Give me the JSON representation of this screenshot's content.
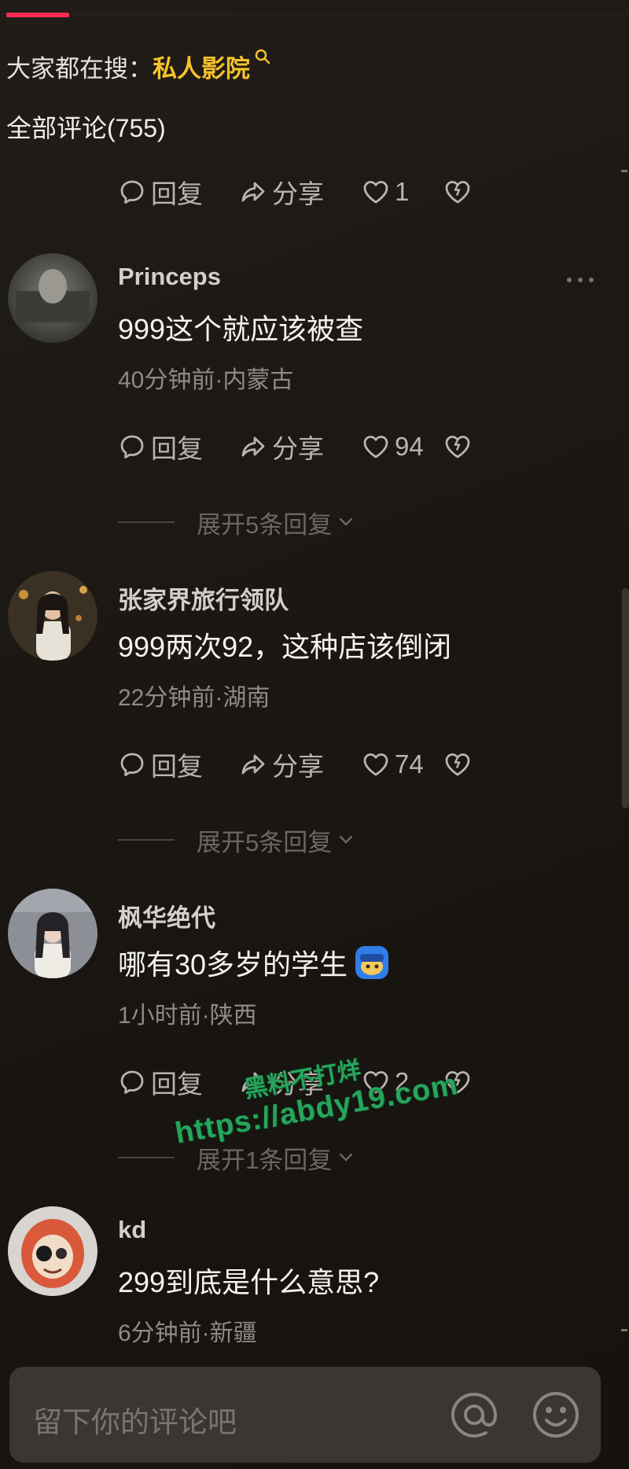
{
  "header": {
    "search_prefix": "大家都在搜：",
    "search_keyword": "私人影院",
    "comments_label": "全部评论(755)"
  },
  "actions": {
    "reply": "回复",
    "share": "分享"
  },
  "orphan_row": {
    "likes": "1"
  },
  "comments": [
    {
      "user": "Princeps",
      "text": "999这个就应该被查",
      "meta": "40分钟前·内蒙古",
      "likes": "94",
      "expand": "展开5条回复"
    },
    {
      "user": "张家界旅行领队",
      "text": "999两次92，这种店该倒闭",
      "meta": "22分钟前·湖南",
      "likes": "74",
      "expand": "展开5条回复"
    },
    {
      "user": "枫华绝代",
      "text": "哪有30多岁的学生",
      "meta": "1小时前·陕西",
      "likes": "2",
      "expand": "展开1条回复"
    },
    {
      "user": "kd",
      "text": "299到底是什么意思?",
      "meta": "6分钟前·新疆"
    }
  ],
  "watermark": {
    "line1": "黑料不打烊",
    "line2": "https://abdy19.com"
  },
  "input": {
    "placeholder": "留下你的评论吧"
  },
  "colors": {
    "accent": "#fe2c55",
    "keyword": "#f4c32c",
    "watermark": "#27a55c"
  }
}
